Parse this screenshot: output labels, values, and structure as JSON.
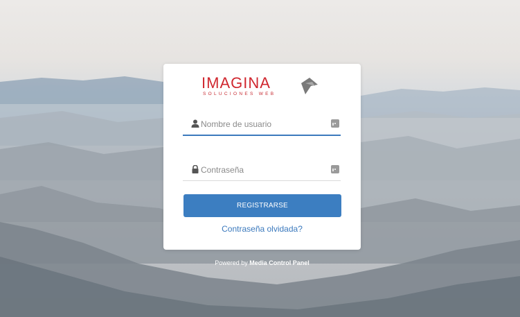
{
  "login": {
    "logo_text": "IMAGINA",
    "logo_subtext": "SOLUCIONES WEB",
    "username_placeholder": "Nombre de usuario",
    "password_placeholder": "Contraseña",
    "submit_label": "REGISTRARSE",
    "forgot_label": "Contraseña olvidada?"
  },
  "footer": {
    "powered_prefix": "Powered by",
    "powered_name": "Media Control Panel"
  },
  "icons": {
    "username": "user-icon",
    "password": "lock-icon",
    "password_manager": "password-manager-icon",
    "logo_mark": "logo-arrow-icon"
  },
  "colors": {
    "accent": "#3c7ec1",
    "brand_red": "#d0272f"
  }
}
